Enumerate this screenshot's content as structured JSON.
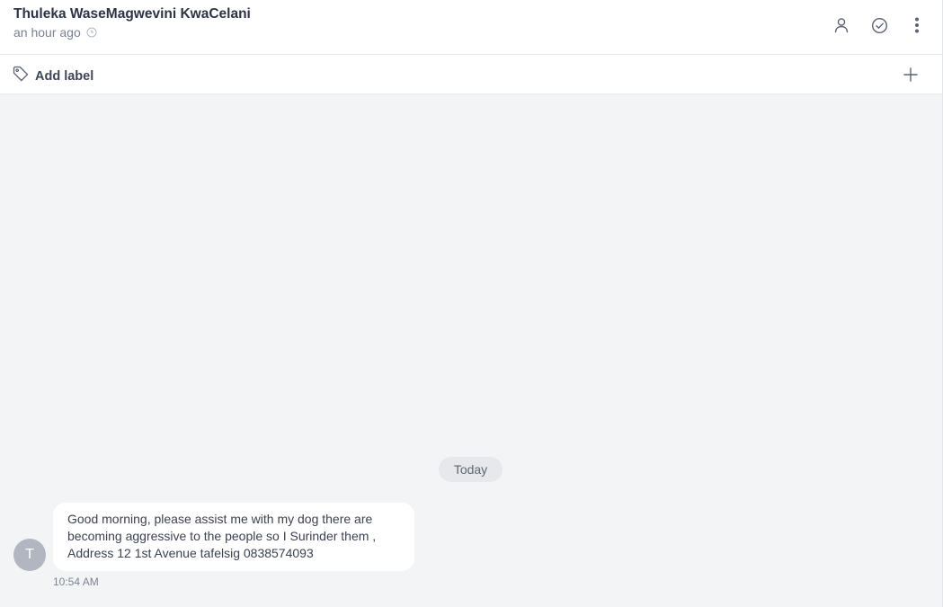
{
  "header": {
    "contact_name": "Thuleka WaseMagwevini KwaCelani",
    "last_seen": "an hour ago",
    "icons": {
      "time": "clock-icon",
      "assign": "person-icon",
      "resolve": "check-circle-icon",
      "more": "more-vertical-icon"
    }
  },
  "labels": {
    "add_label": "Add label",
    "icons": {
      "tag": "tag-icon",
      "add": "plus-icon"
    }
  },
  "conversation": {
    "date_divider": "Today",
    "messages": [
      {
        "avatar_initial": "T",
        "text": "Good morning, please assist me with my dog there are becoming aggressive to the people so I Surinder them , Address 12 1st Avenue tafelsig 0838574093",
        "time": "10:54 AM"
      }
    ]
  },
  "colors": {
    "background": "#f3f4f6",
    "text_primary": "#2b3445",
    "text_muted": "#7a8291",
    "avatar": "#b1b6c0",
    "bubble": "#ffffff"
  }
}
